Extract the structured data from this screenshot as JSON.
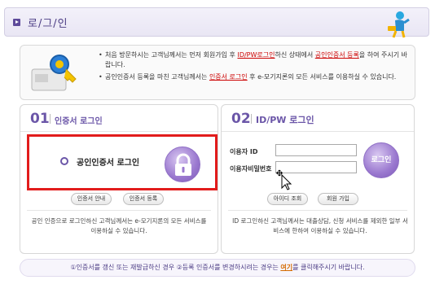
{
  "header": {
    "title": "로/그/인"
  },
  "notice": {
    "items": [
      {
        "before": "처음 방문하시는 고객님께서는 먼저 회원가입 후 ",
        "link1": "ID/PW로그인",
        "middle": "하신 상태에서 ",
        "link2": "공인인증서 등록",
        "after": "을 하여 주시기 바랍니다."
      },
      {
        "before": "공인인증서 등록을 마친 고객님께서는 ",
        "link1": "인증서 로그인",
        "after": " 후 e-모기지론의 모든 서비스를 이용하실 수 있습니다."
      }
    ]
  },
  "cert_panel": {
    "num": "01",
    "title": "인증서 로그인",
    "option_label": "공인인증서 로그인",
    "buttons": {
      "guide": "인증서 안내",
      "register": "인증서 등록"
    },
    "desc": "공인 인증으로 로그인하신 고객님께서는 e-모기지론의 모든 서비스를 이용하실 수 있습니다."
  },
  "idpw_panel": {
    "num": "02",
    "title": "ID/PW 로그인",
    "id_label": "이용자 ID",
    "pw_label": "이용자비밀번호",
    "id_value": "",
    "pw_value": "",
    "login_label": "로그인",
    "buttons": {
      "find_id": "아이디 조회",
      "join": "회원 가입"
    },
    "desc": "ID 로그인하신 고객님께서는 대출상담, 신청 서비스를 제외한 일부 서비스에 한하여 이용하실 수 있습니다."
  },
  "footer": {
    "before": "①인증서를 갱신 또는 재발급하신 경우 ②등록 인증서를 변경하시려는 경우는 ",
    "link": "여기",
    "after": "를 클릭해주시기 바랍니다."
  },
  "icons": {
    "title_bullet": "play-square-icon",
    "header_figure": "person-figure-icon",
    "notice_icon": "key-card-icon",
    "lock": "lock-icon",
    "cursor": "move-cursor-icon"
  },
  "colors": {
    "accent": "#6b56a8",
    "highlight_box": "#e21c1c",
    "link_red": "#cc0000",
    "link_orange": "#d46a00"
  }
}
